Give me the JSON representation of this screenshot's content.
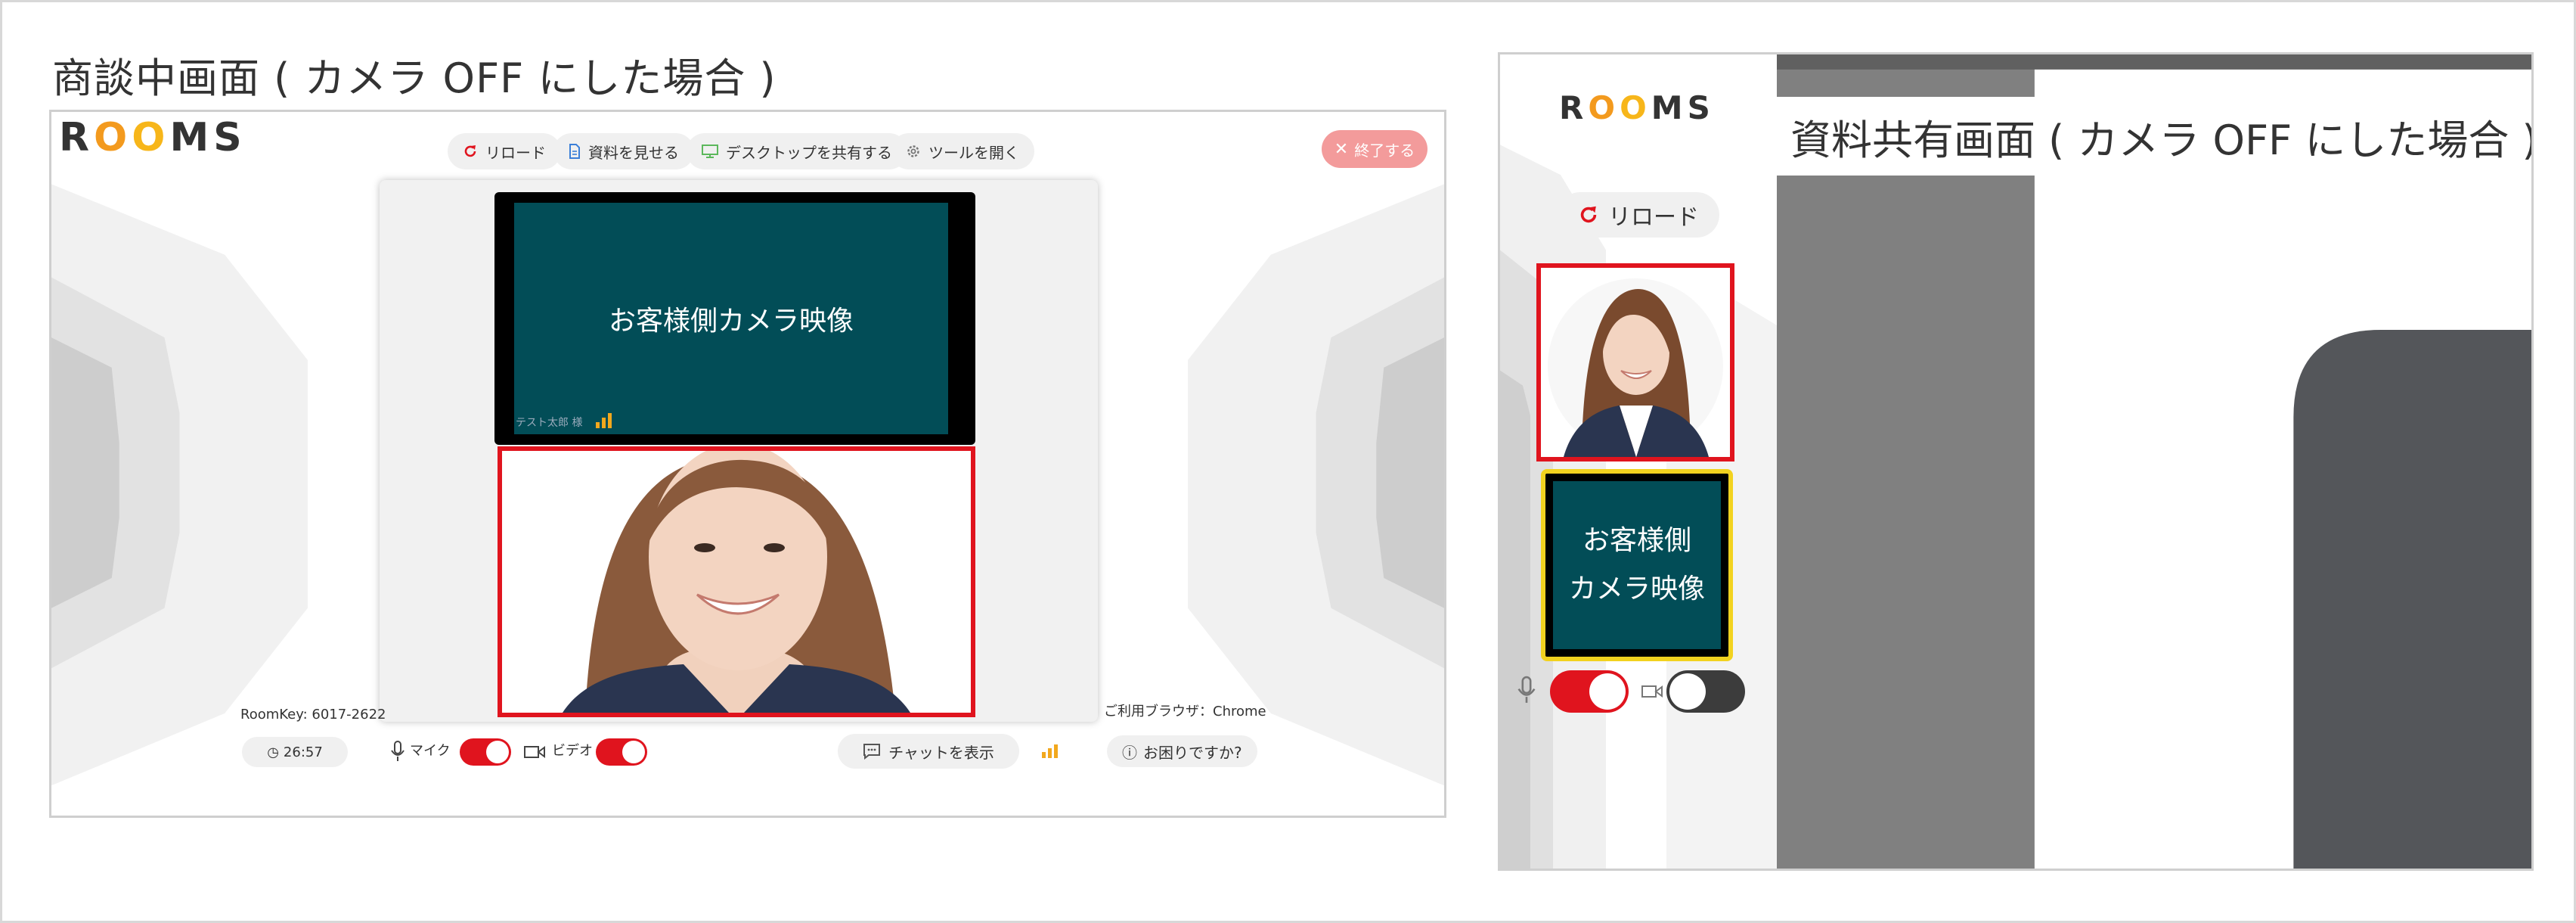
{
  "left_panel": {
    "heading": "商談中画面 ( カメラ OFF にした場合 )",
    "logo": {
      "r": "R",
      "o1": "O",
      "o2": "O",
      "ms": "MS"
    },
    "toolbar": {
      "reload": "リロード",
      "show_material": "資料を見せる",
      "share_desktop": "デスクトップを共有する",
      "open_tools": "ツールを開く"
    },
    "end_button": "終了する",
    "customer_video": {
      "label": "お客様側カメラ映像",
      "name": "テスト太郎 様"
    },
    "room_key": "RoomKey: 6017-2622",
    "browser_info": "ご利用ブラウザ：Chrome",
    "timer": "26:57",
    "mic_label": "マイク",
    "video_label": "ビデオ",
    "mic_on": true,
    "video_on": true,
    "show_chat": "チャットを表示",
    "help": "お困りですか?"
  },
  "right_panel": {
    "heading": "資料共有画面 ( カメラ OFF にした場合 )",
    "logo": {
      "r": "R",
      "o1": "O",
      "o2": "O",
      "ms": "MS"
    },
    "reload": "リロード",
    "customer_thumb": {
      "line1": "お客様側",
      "line2": "カメラ映像"
    },
    "mic_on": true,
    "video_on": false
  },
  "colors": {
    "accent_red": "#e0141e",
    "teal": "#024d57",
    "logo_orange": "#f39a1e",
    "logo_yellow": "#f7b61a",
    "end_button_pink": "#f39b9b",
    "highlight_yellow": "#f2d21f"
  }
}
